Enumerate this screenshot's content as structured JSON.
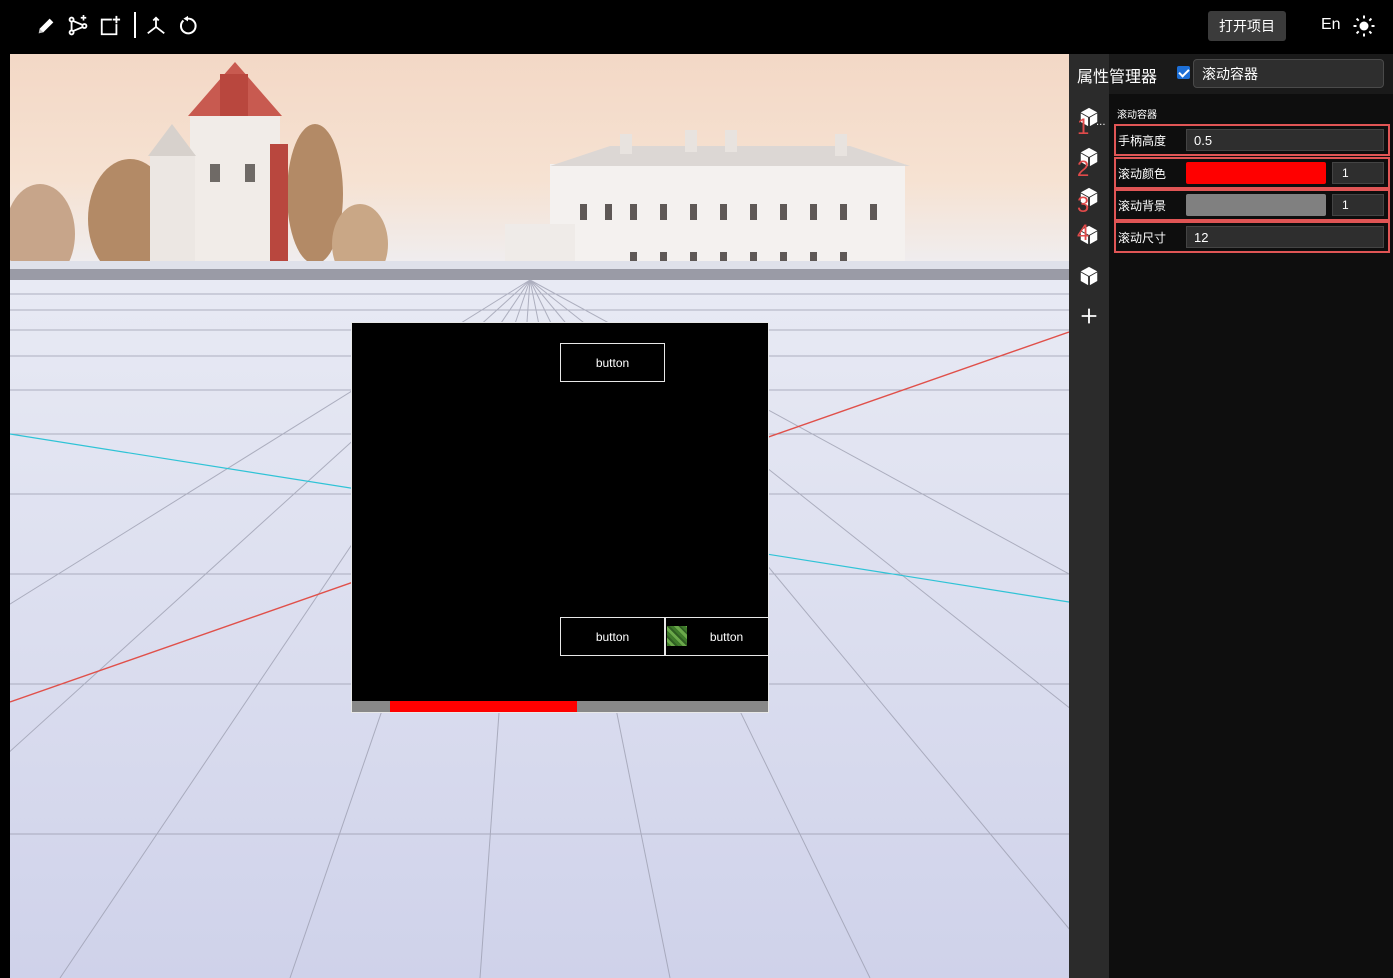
{
  "toolbar": {
    "tools": [
      {
        "icon": "pencil-icon"
      },
      {
        "icon": "node-graph-icon"
      },
      {
        "icon": "add-frame-icon"
      },
      {
        "icon": "axis-gizmo-icon"
      },
      {
        "icon": "reset-rotate-icon"
      }
    ],
    "open_project_label": "打开项目",
    "language_label": "En",
    "theme_icon": "sun-icon"
  },
  "viewport": {
    "scroll_container": {
      "buttons": [
        "button",
        "button",
        "button"
      ],
      "scrollbar": {
        "handle_color": "#ff0000",
        "track_color": "#888888",
        "handle_fraction": 0.45
      }
    }
  },
  "sidebar_icons": {
    "items": [
      "cube-icon",
      "cube-icon",
      "cube-icon",
      "cube-icon",
      "cube-icon",
      "plus-icon"
    ],
    "more_label": "...",
    "annotations": [
      "1",
      "2",
      "3",
      "4"
    ]
  },
  "properties": {
    "title": "属性管理器",
    "visible": true,
    "name_value": "滚动容器",
    "section_label": "滚动容器",
    "handle_height": {
      "label": "手柄高度",
      "value": "0.5"
    },
    "scroll_color": {
      "label": "滚动颜色",
      "color": "#ff0000",
      "alpha": "1"
    },
    "scroll_background": {
      "label": "滚动背景",
      "color": "#808080",
      "alpha": "1"
    },
    "scroll_size": {
      "label": "滚动尺寸",
      "value": "12"
    }
  }
}
